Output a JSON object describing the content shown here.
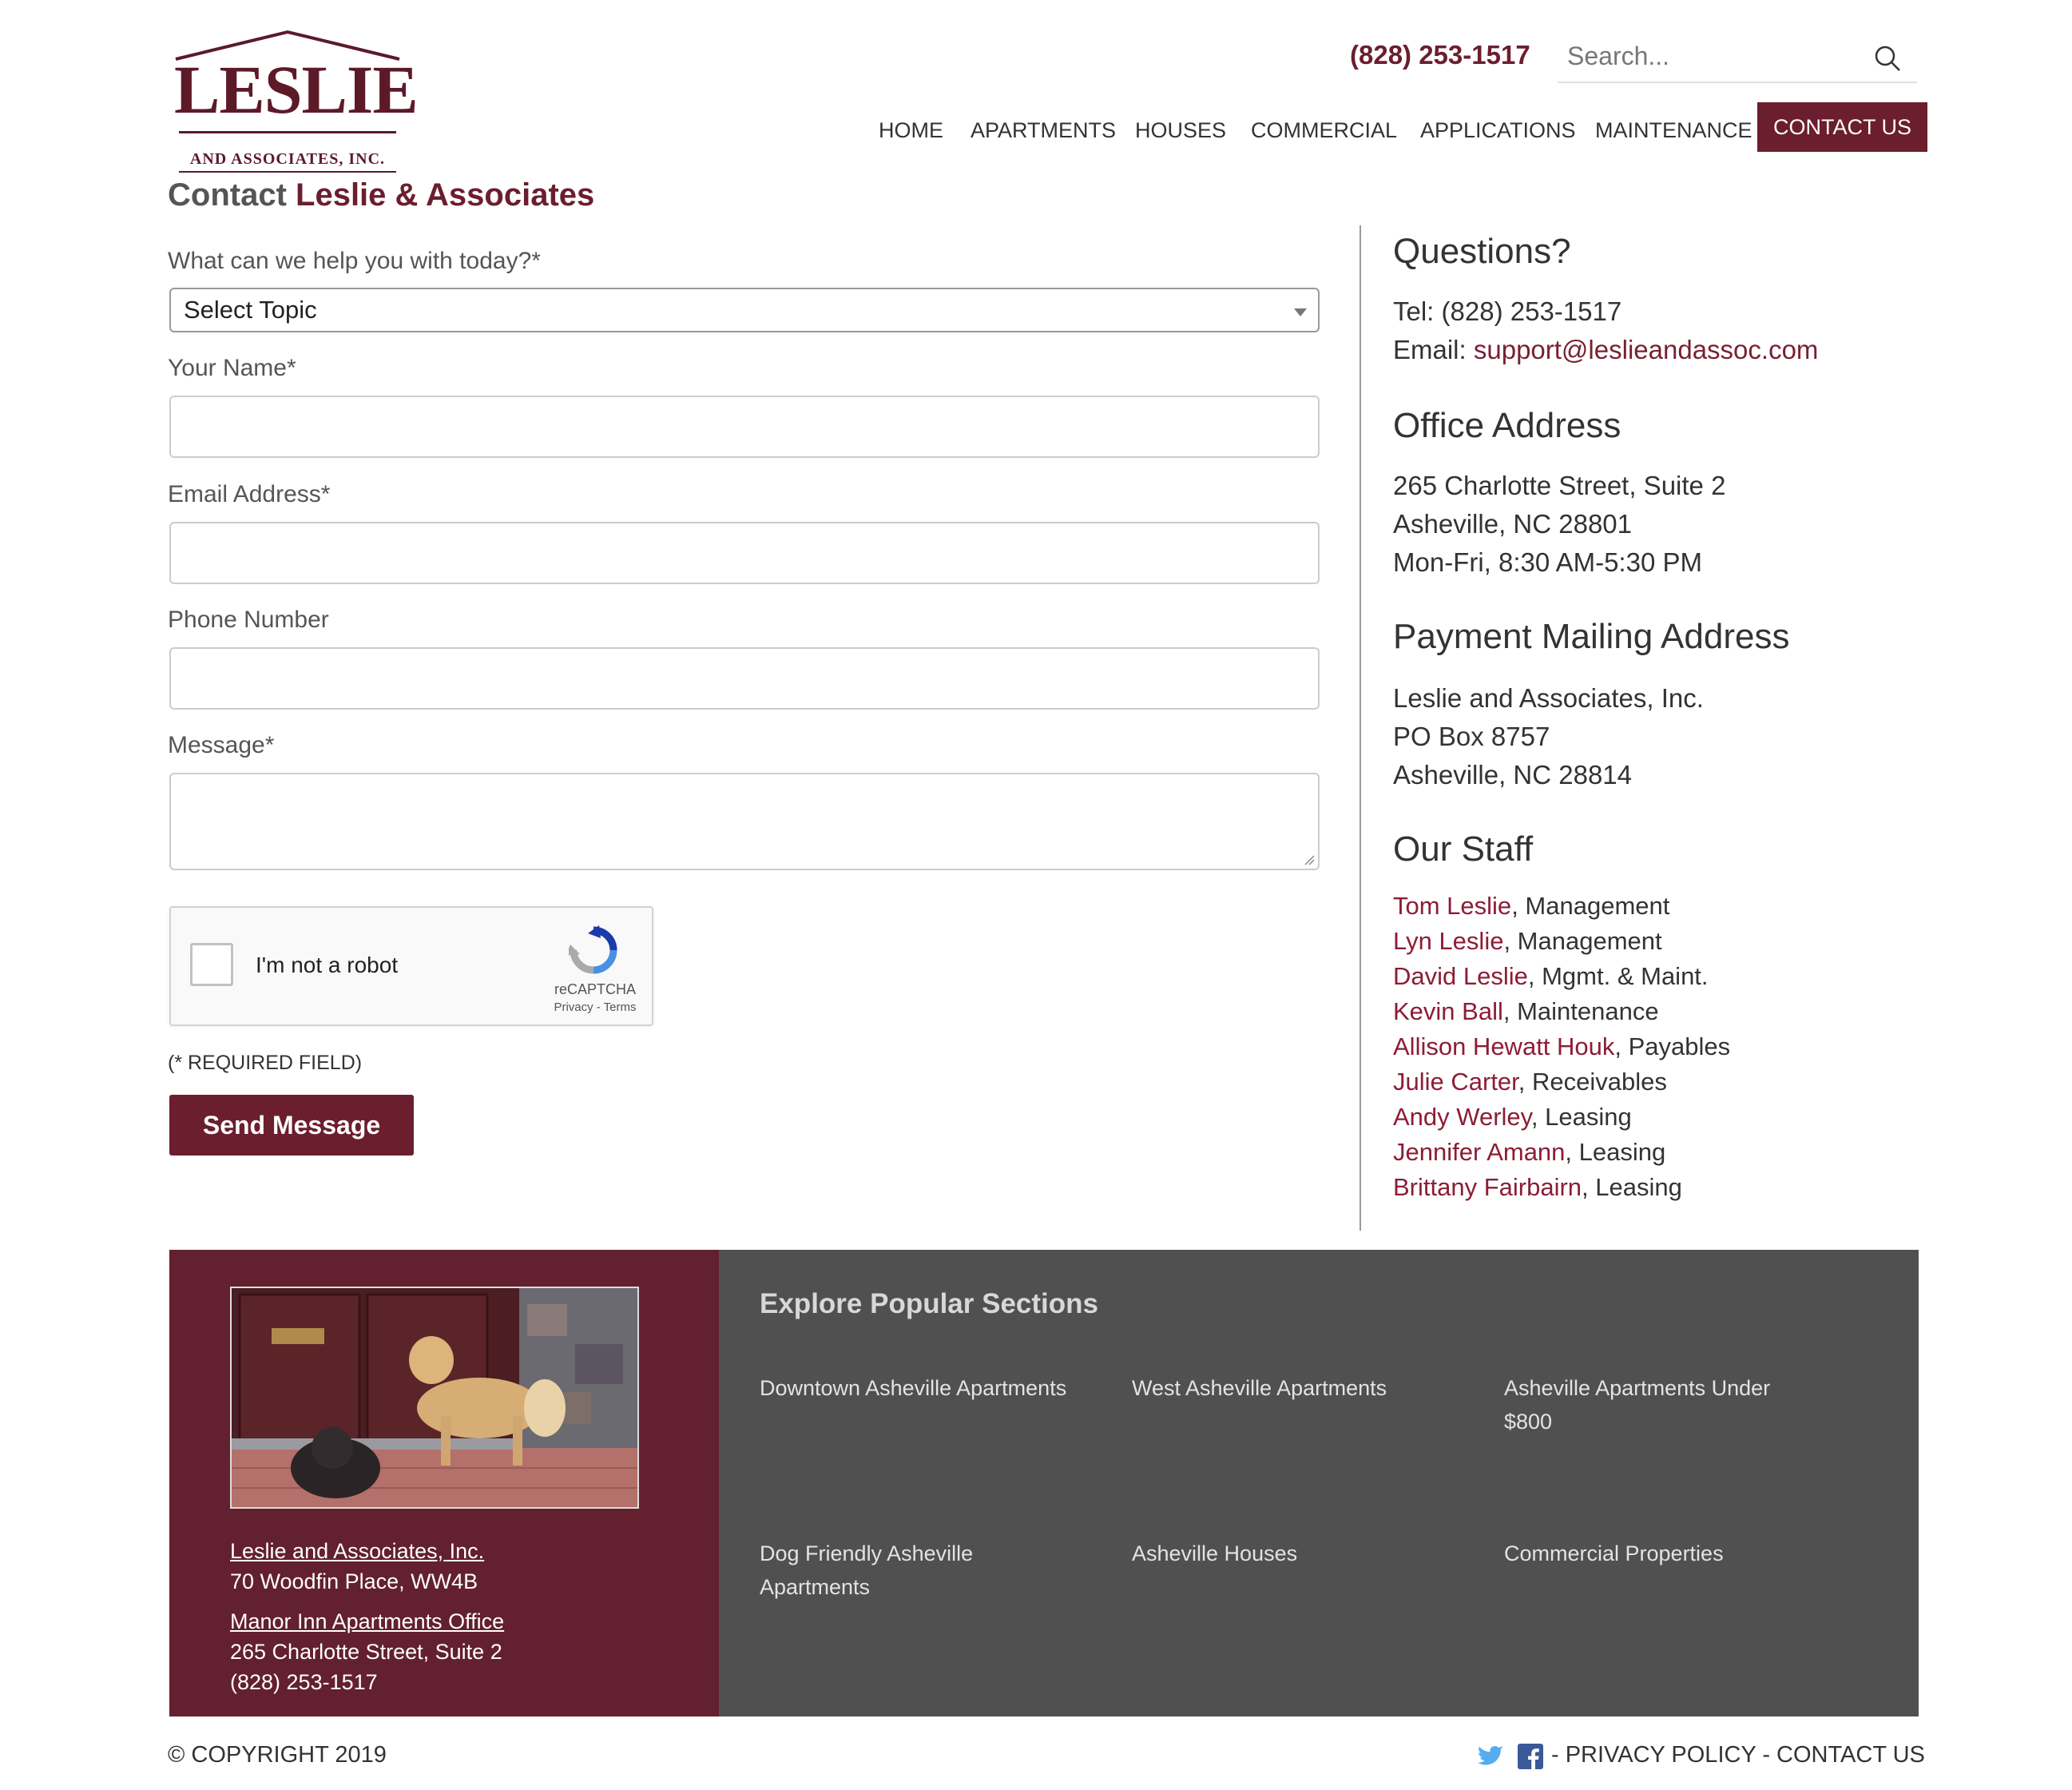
{
  "brand": {
    "logo_word": "LESLIE",
    "logo_sub": "AND ASSOCIATES, INC.",
    "primary_color": "#6b1e2e",
    "link_color": "#8c1d36"
  },
  "header": {
    "phone": "(828) 253-1517",
    "search_placeholder": "Search..."
  },
  "nav": {
    "items": [
      "HOME",
      "APARTMENTS",
      "HOUSES",
      "COMMERCIAL",
      "APPLICATIONS",
      "MAINTENANCE",
      "CONTACT US"
    ],
    "active": "CONTACT US"
  },
  "page": {
    "title_prefix": "Contact",
    "title_accent": "Leslie & Associates"
  },
  "form": {
    "topic_label": "What can we help you with today?*",
    "topic_value": "Select Topic",
    "name_label": "Your Name*",
    "email_label": "Email Address*",
    "phone_label": "Phone Number",
    "message_label": "Message*",
    "recaptcha_text": "I'm not a robot",
    "recaptcha_brand": "reCAPTCHA",
    "recaptcha_links": "Privacy - Terms",
    "required_note": "(* REQUIRED FIELD)",
    "submit_label": "Send Message"
  },
  "sidebar": {
    "questions_heading": "Questions?",
    "tel_label": "Tel:",
    "tel": "(828) 253-1517",
    "email_label": "Email:",
    "email": "support@leslieandassoc.com",
    "office_heading": "Office Address",
    "office_lines": [
      "265 Charlotte Street, Suite 2",
      "Asheville, NC 28801",
      "Mon-Fri, 8:30 AM-5:30 PM"
    ],
    "payment_heading": "Payment Mailing Address",
    "payment_lines": [
      "Leslie and Associates, Inc.",
      "PO Box 8757",
      "Asheville, NC 28814"
    ],
    "staff_heading": "Our Staff",
    "staff": [
      {
        "name": "Tom Leslie",
        "role": ", Management"
      },
      {
        "name": "Lyn Leslie",
        "role": ", Management"
      },
      {
        "name": "David Leslie",
        "role": ", Mgmt. & Maint."
      },
      {
        "name": "Kevin Ball",
        "role": ", Maintenance"
      },
      {
        "name": "Allison Hewatt Houk",
        "role": ", Payables"
      },
      {
        "name": "Julie Carter",
        "role": ", Receivables"
      },
      {
        "name": "Andy Werley",
        "role": ", Leasing"
      },
      {
        "name": "Jennifer Amann",
        "role": ", Leasing"
      },
      {
        "name": "Brittany Fairbairn",
        "role": ", Leasing"
      }
    ]
  },
  "footer": {
    "office1_name": "Leslie and Associates, Inc.",
    "office1_address": "70 Woodfin Place, WW4B",
    "office2_name": "Manor Inn Apartments Office",
    "office2_address": "265 Charlotte Street, Suite 2",
    "office2_phone": "(828) 253-1517",
    "explore_heading": "Explore Popular Sections",
    "explore_links": [
      "Downtown Asheville Apartments",
      "West Asheville Apartments",
      "Asheville Apartments Under $800",
      "Dog Friendly Asheville Apartments",
      "Asheville Houses",
      "Commercial Properties"
    ],
    "left_bg": "#63202e",
    "right_bg": "#505050"
  },
  "bottom": {
    "copyright": "© COPYRIGHT 2019",
    "links_text": " - PRIVACY POLICY - CONTACT US"
  }
}
